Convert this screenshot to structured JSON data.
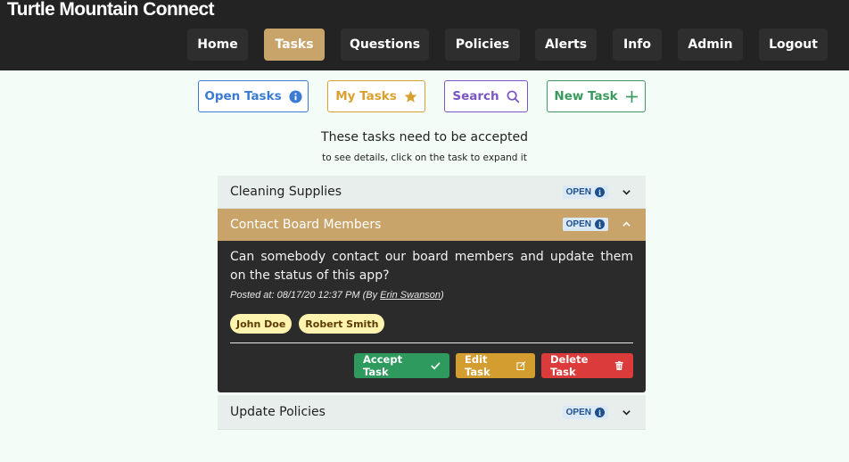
{
  "app": {
    "title": "Turtle Mountain Connect"
  },
  "nav": [
    {
      "label": "Home"
    },
    {
      "label": "Tasks",
      "active": true
    },
    {
      "label": "Questions"
    },
    {
      "label": "Policies"
    },
    {
      "label": "Alerts"
    },
    {
      "label": "Info"
    },
    {
      "label": "Admin"
    },
    {
      "label": "Logout"
    }
  ],
  "actions": {
    "open_tasks": {
      "label": "Open Tasks",
      "icon": "info-circle-icon",
      "color": "#3b7bd3"
    },
    "my_tasks": {
      "label": "My Tasks",
      "icon": "star-icon",
      "color": "#d9a030"
    },
    "search": {
      "label": "Search",
      "icon": "search-icon",
      "color": "#7b55c4"
    },
    "new_task": {
      "label": "New Task",
      "icon": "plus-icon",
      "color": "#3a9a5e"
    }
  },
  "intro": {
    "heading": "These tasks need to be accepted",
    "subheading": "to see details, click on the task to expand it"
  },
  "tasks": [
    {
      "title": "Cleaning Supplies",
      "status": "OPEN",
      "expanded": false
    },
    {
      "title": "Contact Board Members",
      "status": "OPEN",
      "expanded": true,
      "description": "Can somebody contact our board members and update them on the status of this app?",
      "posted_prefix": "Posted at: 08/17/20 12:37 PM (By ",
      "author": "Erin Swanson",
      "posted_suffix": ")",
      "assignees": [
        "John Doe",
        "Robert Smith"
      ],
      "buttons": {
        "accept": "Accept Task",
        "edit": "Edit Task",
        "delete": "Delete Task"
      }
    },
    {
      "title": "Update Policies",
      "status": "OPEN",
      "expanded": false
    }
  ],
  "colors": {
    "header": "#232323",
    "active_nav": "#c8a46a",
    "page_bg": "#f3fcf7"
  }
}
